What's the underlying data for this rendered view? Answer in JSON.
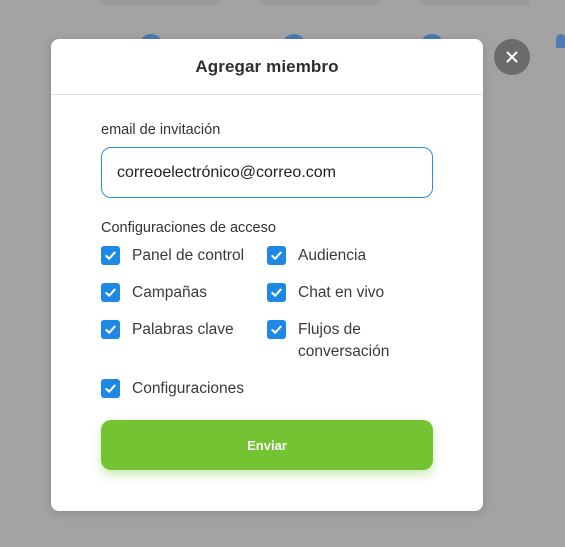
{
  "modal": {
    "title": "Agregar miembro",
    "email_label": "email de invitación",
    "email_value": "correoelectrónico@correo.com",
    "access_label": "Configuraciones de acceso",
    "options": [
      {
        "label": "Panel de control",
        "checked": true
      },
      {
        "label": "Audiencia",
        "checked": true
      },
      {
        "label": "Campañas",
        "checked": true
      },
      {
        "label": "Chat en vivo",
        "checked": true
      },
      {
        "label": "Palabras clave",
        "checked": true
      },
      {
        "label": "Flujos de conversación",
        "checked": true
      },
      {
        "label": "Configuraciones",
        "checked": true
      }
    ],
    "submit_label": "Enviar"
  },
  "icons": {
    "close": "close-icon",
    "check": "check-icon"
  },
  "colors": {
    "accent_blue": "#1e88e5",
    "submit_green": "#74c332",
    "overlay": "#a3a3a3",
    "close_button": "#6b6b6b"
  }
}
